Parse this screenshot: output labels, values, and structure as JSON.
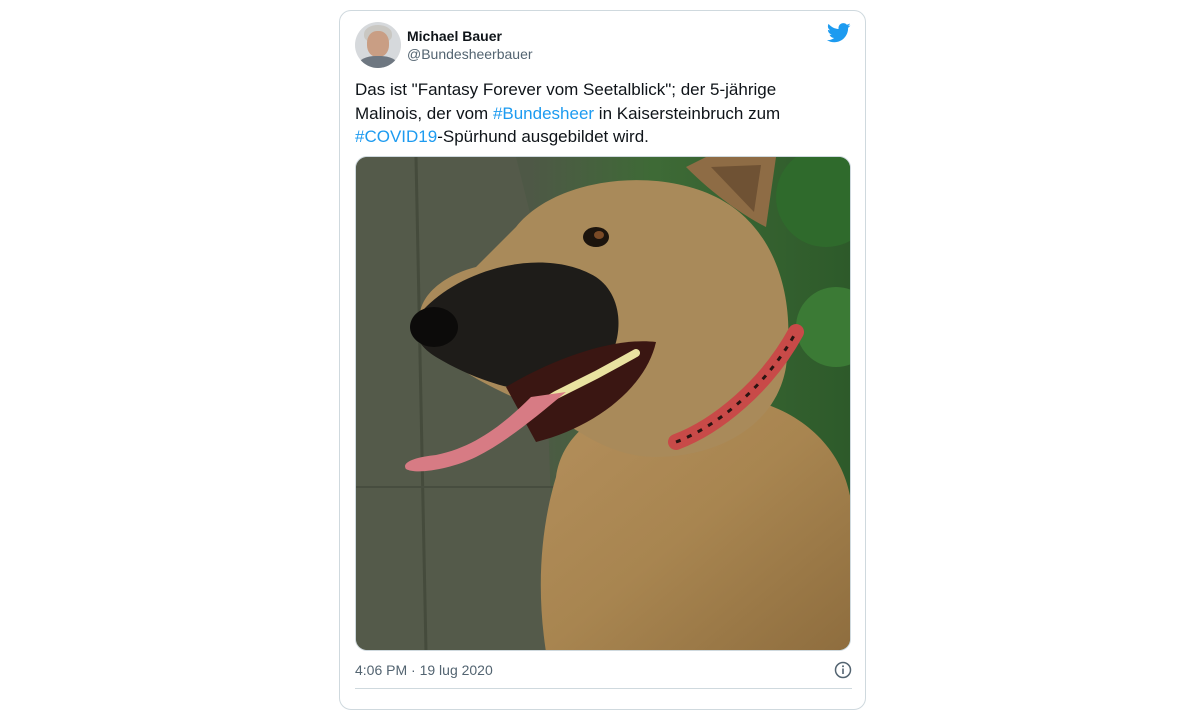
{
  "tweet": {
    "author": {
      "display_name": "Michael Bauer",
      "handle": "@Bundesheerbauer",
      "avatar_icon": "profile-photo"
    },
    "text_parts": [
      {
        "type": "text",
        "value": "Das ist \"Fantasy Forever vom Seetalblick\"; der 5-jährige Malinois, der vom "
      },
      {
        "type": "hashtag",
        "value": "#Bundesheer"
      },
      {
        "type": "text",
        "value": " in Kaisersteinbruch zum "
      },
      {
        "type": "hashtag",
        "value": "#COVID19"
      },
      {
        "type": "text",
        "value": "-Spürhund ausgebildet wird."
      }
    ],
    "timestamp": "4:06 PM · 19 lug 2020",
    "brand_icon": "twitter-bird-icon",
    "info_icon": "info-icon"
  },
  "colors": {
    "brand": "#1d9bf0",
    "text": "#0f1419",
    "muted": "#536471",
    "border": "#cfd9de"
  }
}
